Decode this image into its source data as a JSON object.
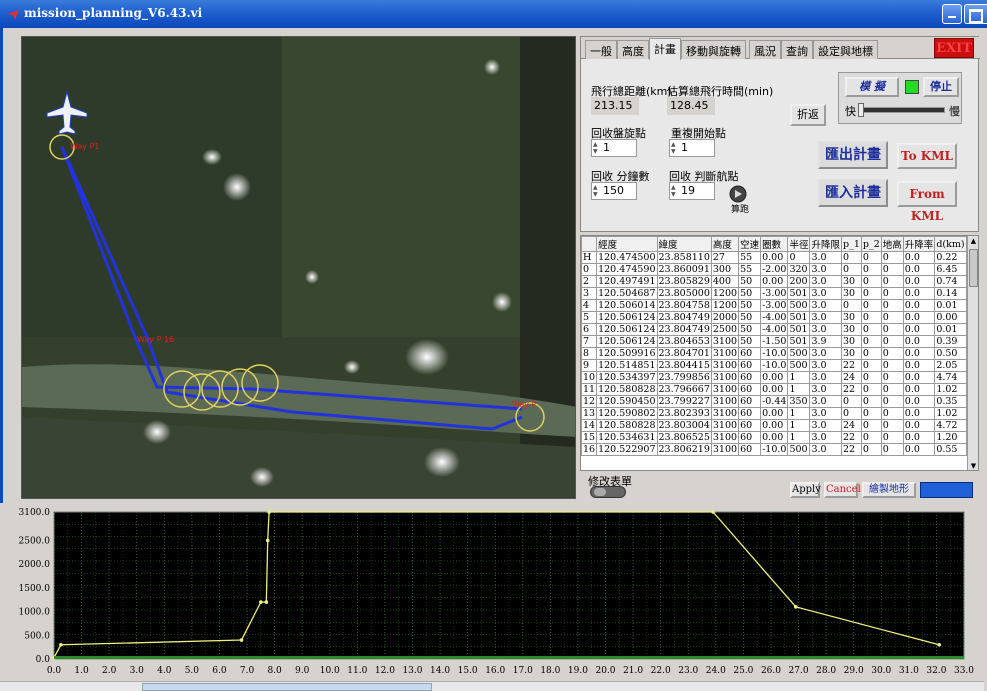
{
  "window": {
    "title": "mission_planning_V6.43.vi"
  },
  "tabs": [
    {
      "label": "一般"
    },
    {
      "label": "高度"
    },
    {
      "label": "計畫",
      "active": true
    },
    {
      "label": "移動與旋轉"
    },
    {
      "label": "風況"
    },
    {
      "label": "查詢"
    },
    {
      "label": "設定與地標"
    }
  ],
  "exit_label": "EXIT",
  "plan": {
    "total_distance_label": "飛行總距離(km)",
    "total_distance_value": "213.15",
    "total_time_label": "估算總飛行時間(min)",
    "total_time_value": "128.45",
    "return_button": "折返",
    "recover_circle_label": "回收盤旋點",
    "recover_circle_value": "1",
    "reset_start_label": "重複開始點",
    "reset_start_value": "1",
    "recover_minutes_label": "回收 分鐘數",
    "recover_minutes_value": "150",
    "recover_judge_label": "回收 判斷航點",
    "recover_judge_value": "19",
    "compute_label": "算跑",
    "simulate_label": "模 擬",
    "stop_label": "停止",
    "fast_label": "快",
    "slow_label": "慢",
    "export_plan": "匯出計畫",
    "to_kml": "To KML",
    "import_plan": "匯入計畫",
    "from_kml": "From KML"
  },
  "table": {
    "headers": [
      "",
      "經度",
      "緯度",
      "高度",
      "空速",
      "圈數",
      "半徑",
      "升降限",
      "p_1",
      "p_2",
      "地高",
      "升降率",
      "d(km)",
      "t(min)"
    ],
    "rows": [
      [
        "H",
        "120.474500",
        "23.858110",
        "27",
        "55",
        "0.00",
        "0",
        "3.0",
        "0",
        "0",
        "0",
        "0.0",
        "0.22",
        "2.8"
      ],
      [
        "0",
        "120.474590",
        "23.860091",
        "300",
        "55",
        "-2.00",
        "320",
        "3.0",
        "0",
        "0",
        "0",
        "0.0",
        "6.45",
        "3.0"
      ],
      [
        "2",
        "120.497491",
        "23.805829",
        "400",
        "50",
        "0.00",
        "200",
        "3.0",
        "30",
        "0",
        "0",
        "0.0",
        "0.74",
        "6.6"
      ],
      [
        "3",
        "120.504687",
        "23.805000",
        "1200",
        "50",
        "-3.00",
        "501",
        "3.0",
        "30",
        "0",
        "0",
        "0.0",
        "0.14",
        "6.2"
      ],
      [
        "4",
        "120.506014",
        "23.804758",
        "1200",
        "50",
        "-3.00",
        "500",
        "3.0",
        "0",
        "0",
        "0",
        "0.0",
        "0.01",
        "8.2"
      ],
      [
        "5",
        "120.506124",
        "23.804749",
        "2000",
        "50",
        "-4.00",
        "501",
        "3.0",
        "30",
        "0",
        "0",
        "0.0",
        "0.00",
        "8.2"
      ],
      [
        "6",
        "120.506124",
        "23.804749",
        "2500",
        "50",
        "-4.00",
        "501",
        "3.0",
        "30",
        "0",
        "0",
        "0.0",
        "0.01",
        "2.6"
      ],
      [
        "7",
        "120.506124",
        "23.804653",
        "3100",
        "50",
        "-1.50",
        "501",
        "3.9",
        "30",
        "0",
        "0",
        "0.0",
        "0.39",
        "17.2"
      ],
      [
        "8",
        "120.509916",
        "23.804701",
        "3100",
        "60",
        "-10.0",
        "500",
        "3.0",
        "30",
        "0",
        "0",
        "0.0",
        "0.50",
        "17.2"
      ],
      [
        "9",
        "120.514851",
        "23.804415",
        "3100",
        "60",
        "-10.0",
        "500",
        "3.0",
        "22",
        "0",
        "0",
        "0.0",
        "2.05",
        "1.0"
      ],
      [
        "10",
        "120.534397",
        "23.799856",
        "3100",
        "60",
        "0.00",
        "1",
        "3.0",
        "24",
        "0",
        "0",
        "0.0",
        "4.74",
        "2.5"
      ],
      [
        "11",
        "120.580828",
        "23.796667",
        "3100",
        "60",
        "0.00",
        "1",
        "3.0",
        "22",
        "0",
        "0",
        "0.0",
        "1.02",
        "1.1"
      ],
      [
        "12",
        "120.590450",
        "23.799227",
        "3100",
        "60",
        "-0.44",
        "350",
        "3.0",
        "0",
        "0",
        "0",
        "0.0",
        "0.35",
        "0.3"
      ],
      [
        "13",
        "120.590802",
        "23.802393",
        "3100",
        "60",
        "0.00",
        "1",
        "3.0",
        "0",
        "0",
        "0",
        "0.0",
        "1.02",
        "0.6"
      ],
      [
        "14",
        "120.580828",
        "23.803004",
        "3100",
        "60",
        "0.00",
        "1",
        "3.0",
        "24",
        "0",
        "0",
        "0.0",
        "4.72",
        "2.6"
      ],
      [
        "15",
        "120.534631",
        "23.806525",
        "3100",
        "60",
        "0.00",
        "1",
        "3.0",
        "22",
        "0",
        "0",
        "0.0",
        "1.20",
        "21.0"
      ],
      [
        "16",
        "120.522907",
        "23.806219",
        "3100",
        "60",
        "-10.0",
        "500",
        "3.0",
        "22",
        "0",
        "0",
        "0.0",
        "0.55",
        "15.6"
      ]
    ]
  },
  "bottom": {
    "edit_table_label": "修改表單",
    "apply": "Apply",
    "cancel": "Cancel",
    "draw_terrain": "繪製地形"
  },
  "colors": {
    "trace": "#f0f080",
    "grid": "#3a7a3a",
    "route": "#2233dd",
    "circles": "#e0d060"
  },
  "chart_data": {
    "type": "line",
    "title": "",
    "xlabel": "",
    "ylabel": "",
    "xlim": [
      0,
      33
    ],
    "ylim": [
      0,
      3100
    ],
    "xticks": [
      "0.0",
      "1.0",
      "2.0",
      "3.0",
      "4.0",
      "5.0",
      "6.0",
      "7.0",
      "8.0",
      "9.0",
      "10.0",
      "11.0",
      "12.0",
      "13.0",
      "14.0",
      "15.0",
      "16.0",
      "17.0",
      "18.0",
      "19.0",
      "20.0",
      "21.0",
      "22.0",
      "23.0",
      "24.0",
      "25.0",
      "26.0",
      "27.0",
      "28.0",
      "29.0",
      "30.0",
      "31.0",
      "32.0",
      "33.0"
    ],
    "yticks": [
      "0.0",
      "500.0",
      "1000.0",
      "1500.0",
      "2000.0",
      "2500.0",
      "3100.0"
    ],
    "ytick_values": [
      0,
      500,
      1000,
      1500,
      2000,
      2500,
      3100
    ],
    "series": [
      {
        "color": "#f0f080",
        "x": [
          0.0,
          0.25,
          6.8,
          7.5,
          7.7,
          7.75,
          7.8,
          23.9,
          26.9,
          32.1
        ],
        "y": [
          27,
          300,
          400,
          1200,
          1200,
          2500,
          3100,
          3100,
          1100,
          300
        ]
      }
    ]
  }
}
